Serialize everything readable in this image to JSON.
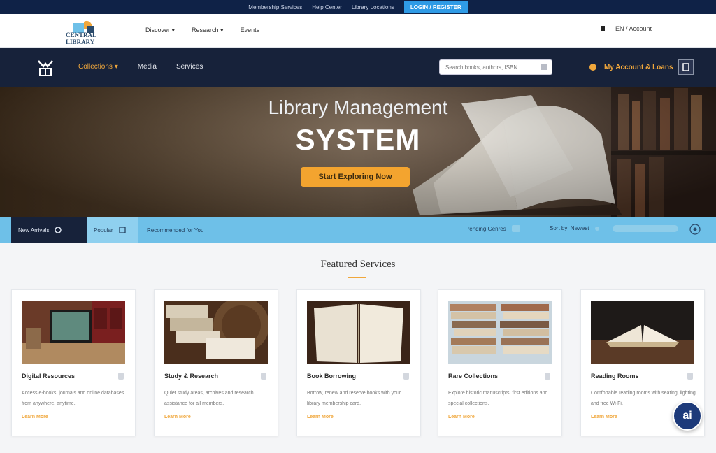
{
  "topbar": {
    "links": [
      "Membership Services",
      "Help Center",
      "Library Locations"
    ],
    "cta_label": "LOGIN / REGISTER"
  },
  "header": {
    "logo_text": "CENTRAL LIBRARY",
    "nav": [
      "Discover ▾",
      "Research ▾",
      "Events"
    ],
    "lang_label": "EN / Account"
  },
  "navbar": {
    "items": [
      "Collections ▾",
      "Media",
      "Services"
    ],
    "search_placeholder": "Search books, authors, ISBN…",
    "account_label": "My Account & Loans"
  },
  "hero": {
    "title": "Library Management",
    "subtitle": "SYSTEM",
    "cta_label": "Start Exploring Now"
  },
  "tabs": {
    "items": [
      "New Arrivals",
      "Popular",
      "Recommended for You"
    ],
    "trending_label": "Trending Genres",
    "sort_label": "Sort by: Newest"
  },
  "section": {
    "title": "Featured Services"
  },
  "cards": [
    {
      "title": "Digital Resources",
      "desc": "Access e-books, journals and online databases from anywhere, anytime.",
      "more": "Learn More"
    },
    {
      "title": "Study & Research",
      "desc": "Quiet study areas, archives and research assistance for all members.",
      "more": "Learn More"
    },
    {
      "title": "Book Borrowing",
      "desc": "Borrow, renew and reserve books with your library membership card.",
      "more": "Learn More"
    },
    {
      "title": "Rare Collections",
      "desc": "Explore historic manuscripts, first editions and special collections.",
      "more": "Learn More"
    },
    {
      "title": "Reading Rooms",
      "desc": "Comfortable reading rooms with seating, lighting and free Wi-Fi.",
      "more": "Learn More"
    }
  ],
  "chat": {
    "label": "ai"
  },
  "colors": {
    "navy": "#17223a",
    "accent_orange": "#f3a42f",
    "tab_blue": "#6ec0e8",
    "topstrip": "#0f2247"
  }
}
